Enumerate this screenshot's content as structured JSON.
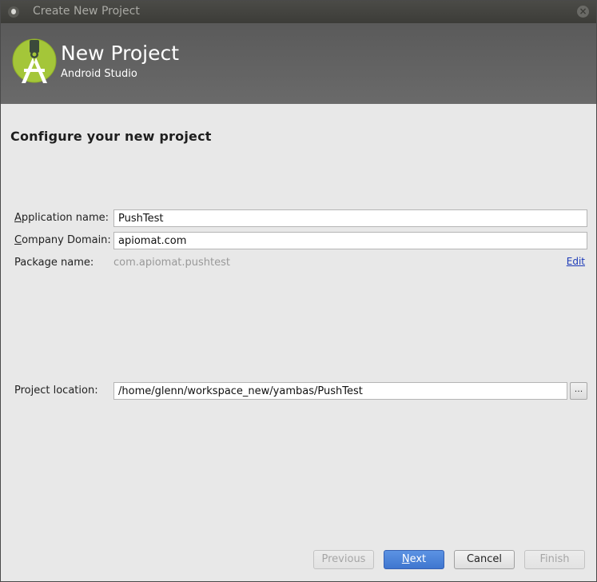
{
  "window": {
    "title": "Create New Project"
  },
  "header": {
    "title": "New Project",
    "subtitle": "Android Studio"
  },
  "main": {
    "section_title": "Configure your new project",
    "app_name": {
      "label_mnemonic": "A",
      "label_rest": "pplication name:",
      "value": "PushTest"
    },
    "company": {
      "label_mnemonic": "C",
      "label_rest": "ompany Domain:",
      "value": "apiomat.com"
    },
    "package": {
      "label": "Package name:",
      "value": "com.apiomat.pushtest",
      "edit_link": "Edit"
    },
    "location": {
      "label": "Project location:",
      "value": "/home/glenn/workspace_new/yambas/PushTest",
      "browse_label": "..."
    }
  },
  "buttons": {
    "previous": "Previous",
    "next_mnemonic": "N",
    "next_rest": "ext",
    "cancel": "Cancel",
    "finish": "Finish"
  },
  "colors": {
    "android_green": "#a4c639",
    "primary_button": "#4a80d8"
  }
}
